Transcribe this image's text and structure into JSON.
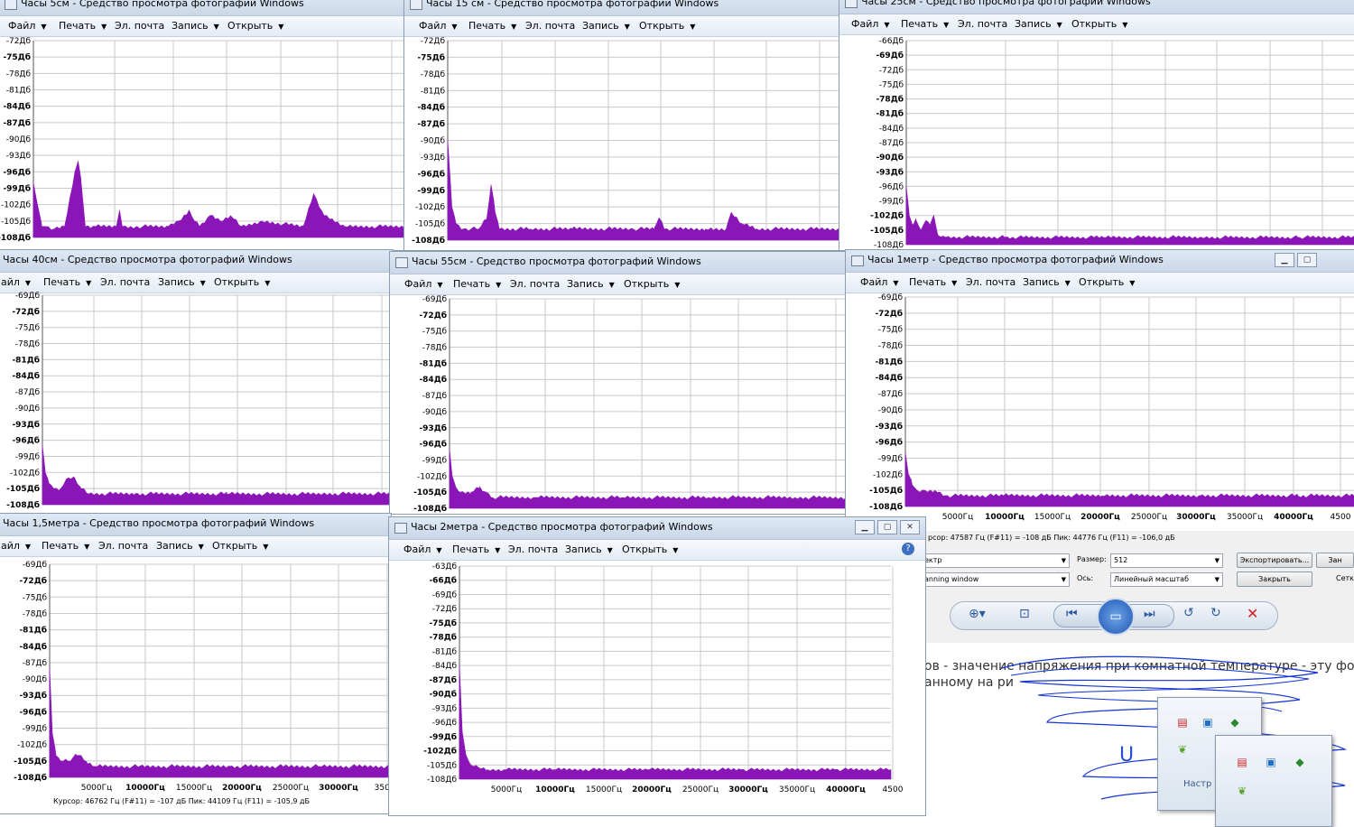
{
  "menu": {
    "file": "Файл",
    "print": "Печать",
    "email": "Эл. почта",
    "burn": "Запись",
    "open": "Открыть",
    "file_partial": "айл"
  },
  "windows": [
    {
      "title": "Часы 5см - Средство просмотра фотографий Windows"
    },
    {
      "title": "Часы 15 см - Средство просмотра фотографий Windows"
    },
    {
      "title": "Часы 25см - Средство просмотра фотографий Windows"
    },
    {
      "title": "Часы 40см - Средство просмотра фотографий Windows"
    },
    {
      "title": "Часы 55см - Средство просмотра фотографий Windows"
    },
    {
      "title": "Часы 1метр - Средство просмотра фотографий Windows"
    },
    {
      "title": "Часы 1,5метра - Средство просмотра фотографий Windows"
    },
    {
      "title": "Часы 2метра - Средство просмотра фотографий Windows"
    }
  ],
  "freq_labels": [
    "5000Гц",
    "10000Гц",
    "15000Гц",
    "20000Гц",
    "25000Гц",
    "30000Гц",
    "35000Гц",
    "40000Гц",
    "4500"
  ],
  "freq_labels_w7": [
    "5000Гц",
    "10000Гц",
    "15000Гц",
    "20000Гц",
    "25000Гц",
    "30000Гц",
    "35000"
  ],
  "status_w6": "рсор: 47587 Гц (F#11) = -108 дБ   Пик: 44776 Гц (F11) = -106,0 дБ",
  "status_w7": "Курсор: 46762 Гц (F#11) = -107 дБ   Пик: 44109 Гц (F11) = -105,9 дБ",
  "analyzer": {
    "type_value": "ектр",
    "window_value": "anning window",
    "size_label": "Размер:",
    "size_value": "512",
    "axis_label": "Ось:",
    "axis_value": "Линейный масштаб",
    "export_button": "Экспортировать...",
    "close_button": "Закрыть",
    "right_partial_1": "Зан",
    "right_partial_2": "Сетк"
  },
  "doc_text": {
    "line1": "ов - значение напряжения при комнатной температуре - эту формулу",
    "line2": "анному на ри",
    "formula": "U",
    "tray_label": "Настр"
  },
  "chart_data": [
    {
      "type": "area",
      "window": "Часы 5см",
      "xlabel": "",
      "ylabel": "",
      "ylim": [
        -108,
        -72
      ],
      "yticks": [
        "-72Дб",
        "-75Дб",
        "-78Дб",
        "-81Дб",
        "-84Дб",
        "-87Дб",
        "-90Дб",
        "-93Дб",
        "-96Дб",
        "-99Дб",
        "-102Дб",
        "-105Дб",
        "-108Дб"
      ],
      "x_hz": [
        0,
        500,
        800,
        1200,
        2000,
        3000,
        4000,
        4300,
        4600,
        5000,
        6000,
        8000,
        8300,
        8600,
        10000,
        13000,
        14000,
        15000,
        15500,
        16000,
        17000,
        18000,
        19000,
        20000,
        22000,
        26000,
        27000,
        28000,
        30000,
        36000
      ],
      "y_db": [
        -98,
        -103,
        -106,
        -106,
        -106.5,
        -106,
        -96,
        -94,
        -98,
        -106,
        -106,
        -106,
        -103,
        -106,
        -106,
        -106,
        -105,
        -103,
        -105,
        -106,
        -104,
        -105,
        -104,
        -106,
        -105,
        -106,
        -100,
        -104,
        -106,
        -106
      ]
    },
    {
      "type": "area",
      "window": "Часы 15 см",
      "xlabel": "",
      "ylabel": "",
      "ylim": [
        -108,
        -72
      ],
      "yticks": [
        "-72Дб",
        "-75Дб",
        "-78Дб",
        "-81Дб",
        "-84Дб",
        "-87Дб",
        "-90Дб",
        "-93Дб",
        "-96Дб",
        "-99Дб",
        "-102Дб",
        "-105Дб",
        "-108Дб"
      ],
      "x_hz": [
        0,
        400,
        800,
        1500,
        3000,
        3800,
        4200,
        4600,
        5000,
        8000,
        12000,
        18000,
        20000,
        20500,
        21000,
        25000,
        27000,
        27500,
        28500,
        30000,
        38000
      ],
      "y_db": [
        -90,
        -102,
        -105,
        -106,
        -106,
        -104,
        -98,
        -103,
        -106,
        -106,
        -106,
        -106,
        -106,
        -104,
        -106,
        -106,
        -106,
        -103,
        -105,
        -106,
        -106
      ]
    },
    {
      "type": "area",
      "window": "Часы 25см",
      "xlabel": "",
      "ylabel": "",
      "ylim": [
        -108,
        -66
      ],
      "yticks": [
        "-66Дб",
        "-69Дб",
        "-72Дб",
        "-75Дб",
        "-78Дб",
        "-81Дб",
        "-84Дб",
        "-87Дб",
        "-90Дб",
        "-93Дб",
        "-96Дб",
        "-99Дб",
        "-102Дб",
        "-105Дб",
        "-108Дб"
      ],
      "x_hz": [
        0,
        300,
        700,
        1000,
        1500,
        2000,
        2400,
        2800,
        3200,
        4000,
        10000,
        20000,
        30000,
        40000,
        46000
      ],
      "y_db": [
        -96,
        -102,
        -104,
        -103,
        -105,
        -103,
        -104,
        -102,
        -106,
        -106.5,
        -106.5,
        -106.5,
        -106.5,
        -106.5,
        -106.5
      ]
    },
    {
      "type": "area",
      "window": "Часы 40см",
      "xlabel": "",
      "ylabel": "",
      "ylim": [
        -108,
        -69
      ],
      "yticks": [
        "-69Дб",
        "-72Дб",
        "-75Дб",
        "-78Дб",
        "-81Дб",
        "-84Дб",
        "-87Дб",
        "-90Дб",
        "-93Дб",
        "-96Дб",
        "-99Дб",
        "-102Дб",
        "-105Дб",
        "-108Дб"
      ],
      "x_hz": [
        0,
        300,
        700,
        1200,
        2000,
        2800,
        3500,
        4200,
        5000,
        10000,
        20000,
        30000,
        38000
      ],
      "y_db": [
        -97,
        -102,
        -104,
        -105,
        -105,
        -103,
        -103,
        -105,
        -106,
        -106,
        -106,
        -106,
        -106
      ]
    },
    {
      "type": "area",
      "window": "Часы 55см",
      "xlabel": "",
      "ylabel": "",
      "ylim": [
        -108,
        -69
      ],
      "yticks": [
        "-69Дб",
        "-72Дб",
        "-75Дб",
        "-78Дб",
        "-81Дб",
        "-84Дб",
        "-87Дб",
        "-90Дб",
        "-93Дб",
        "-96Дб",
        "-99Дб",
        "-102Дб",
        "-105Дб",
        "-108Дб"
      ],
      "x_hz": [
        0,
        300,
        700,
        1200,
        2500,
        3500,
        4200,
        5000,
        10000,
        20000,
        30000,
        40000,
        46000
      ],
      "y_db": [
        -97,
        -102,
        -104,
        -105,
        -105,
        -104,
        -105,
        -106,
        -106,
        -106,
        -106,
        -106,
        -106
      ]
    },
    {
      "type": "area",
      "window": "Часы 1метр",
      "xlabel": "",
      "ylabel": "",
      "ylim": [
        -108,
        -69
      ],
      "yticks": [
        "-69Дб",
        "-72Дб",
        "-75Дб",
        "-78Дб",
        "-81Дб",
        "-84Дб",
        "-87Дб",
        "-90Дб",
        "-93Дб",
        "-96Дб",
        "-99Дб",
        "-102Дб",
        "-105Дб",
        "-108Дб"
      ],
      "x_hz": [
        0,
        300,
        700,
        1200,
        2000,
        3000,
        4000,
        10000,
        20000,
        30000,
        40000,
        46000
      ],
      "y_db": [
        -98,
        -102,
        -104,
        -105,
        -105,
        -105,
        -106,
        -106,
        -106,
        -106,
        -106,
        -106
      ]
    },
    {
      "type": "area",
      "window": "Часы 1,5метра",
      "xlabel": "",
      "ylabel": "",
      "ylim": [
        -108,
        -69
      ],
      "yticks": [
        "-69Дб",
        "-72Дб",
        "-75Дб",
        "-78Дб",
        "-81Дб",
        "-84Дб",
        "-87Дб",
        "-90Дб",
        "-93Дб",
        "-96Дб",
        "-99Дб",
        "-102Дб",
        "-105Дб",
        "-108Дб"
      ],
      "x_hz": [
        0,
        300,
        700,
        1200,
        2000,
        3000,
        3500,
        4200,
        5000,
        10000,
        20000,
        30000,
        38000
      ],
      "y_db": [
        -88,
        -100,
        -104,
        -105,
        -105,
        -104,
        -104,
        -105.5,
        -106,
        -106,
        -106,
        -106,
        -106
      ]
    },
    {
      "type": "area",
      "window": "Часы 2метра",
      "xlabel": "",
      "ylabel": "",
      "ylim": [
        -108,
        -63
      ],
      "yticks": [
        "-63Дб",
        "-66Дб",
        "-69Дб",
        "-72Дб",
        "-75Дб",
        "-78Дб",
        "-81Дб",
        "-84Дб",
        "-87Дб",
        "-90Дб",
        "-93Дб",
        "-96Дб",
        "-99Дб",
        "-102Дб",
        "-105Дб",
        "-108Дб"
      ],
      "x_hz": [
        0,
        300,
        700,
        1200,
        2000,
        3000,
        5000,
        10000,
        20000,
        30000,
        40000,
        46000
      ],
      "y_db": [
        -84,
        -98,
        -103,
        -105,
        -105.5,
        -106,
        -106,
        -106,
        -106,
        -106,
        -106,
        -106
      ]
    }
  ],
  "colors": {
    "spectrum": "#8b16b8",
    "grid": "#c9c9c9",
    "help": "#3c6fc2"
  },
  "icons": [
    "window-icon",
    "dropdown-arrow",
    "help-icon",
    "zoom-icon",
    "fit-icon",
    "prev-icon",
    "slideshow-icon",
    "next-icon",
    "rotate-left-icon",
    "rotate-right-icon",
    "delete-icon"
  ]
}
